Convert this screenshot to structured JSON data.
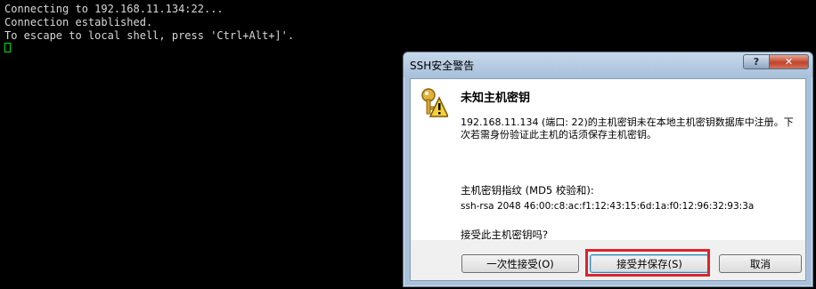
{
  "terminal": {
    "lines": [
      "Connecting to 192.168.11.134:22...",
      "Connection established.",
      "To escape to local shell, press 'Ctrl+Alt+]'."
    ]
  },
  "dialog": {
    "title": "SSH安全警告",
    "help_label": "?",
    "close_label": "✕",
    "heading": "未知主机密钥",
    "message": "192.168.11.134 (端口: 22)的主机密钥未在本地主机密钥数据库中注册。下次若需身份验证此主机的话须保存主机密钥。",
    "fingerprint_label": "主机密钥指纹 (MD5 校验和):",
    "fingerprint_value": "ssh-rsa 2048 46:00:c8:ac:f1:12:43:15:6d:1a:f0:12:96:32:93:3a",
    "question": "接受此主机密钥吗?",
    "buttons": {
      "accept_once": "一次性接受(O)",
      "accept_save": "接受并保存(S)",
      "cancel": "取消"
    }
  },
  "colors": {
    "cursor": "#00e000",
    "highlight": "#d9262a"
  },
  "icons": {
    "warning": "key-warning-icon"
  }
}
